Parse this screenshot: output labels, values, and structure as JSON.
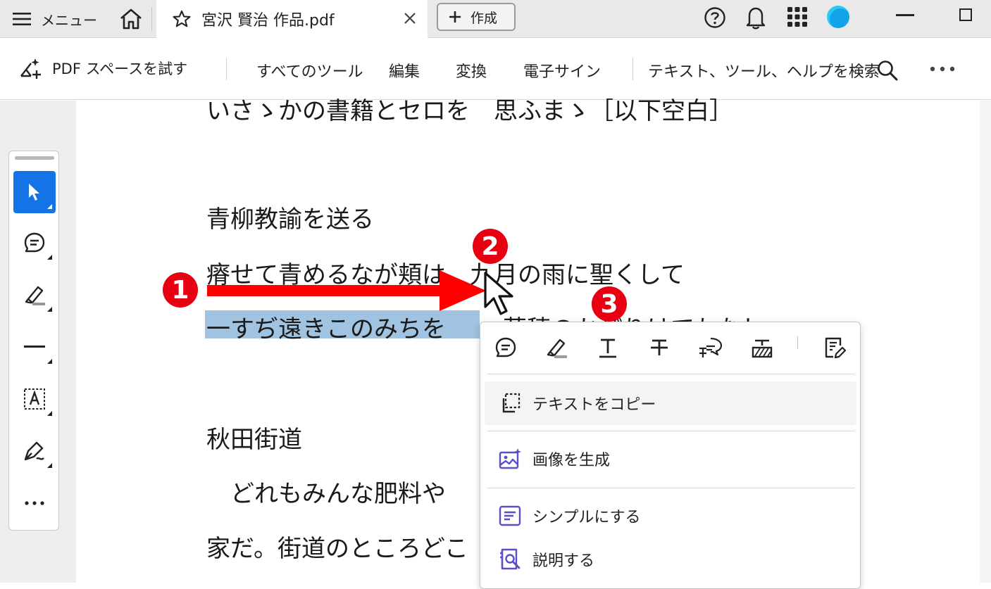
{
  "tabbar": {
    "menu_label": "メニュー",
    "tab_title": "宮沢 賢治 作品.pdf",
    "create_label": "作成",
    "icons": [
      "menu-icon",
      "home-icon",
      "star-icon",
      "close-icon",
      "plus-icon",
      "help-icon",
      "bell-icon",
      "apps-icon",
      "avatar",
      "minimize-icon",
      "maximize-icon"
    ]
  },
  "toolbar": {
    "pdf_space_label": "PDF スペースを試す",
    "items": [
      "すべてのツール",
      "編集",
      "変換",
      "電子サイン"
    ],
    "search_label": "テキスト、ツール、ヘルプを検索"
  },
  "rail": {
    "tools": [
      "select-tool",
      "comment-tool",
      "highlight-tool",
      "line-tool",
      "text-box-tool",
      "draw-tool",
      "more-tools"
    ],
    "more_label": "…"
  },
  "document": {
    "line_top": "いさゝかの書籍とセロを　思ふまゝ［以下空白］",
    "heading1": "青柳教諭を送る",
    "line2": "瘠せて青めるなが頬は　九月の雨に聖くして",
    "line3_selected": "一すぢ遠きこのみちを",
    "line3_rest": "　草穂のかぜりけてもなし",
    "heading2": "秋田街道",
    "line4": "　どれもみんな肥料や",
    "line5": "家だ。街道のところどこ"
  },
  "callouts": [
    "1",
    "2",
    "3"
  ],
  "popup": {
    "icons": [
      "comment-icon",
      "highlight-icon",
      "underline-icon",
      "strikethrough-icon",
      "replace-text-icon",
      "redact-icon",
      "edit-text-icon"
    ],
    "items": [
      {
        "label": "テキストをコピー",
        "icon": "copy-icon"
      },
      {
        "label": "画像を生成",
        "icon": "generate-image-icon"
      },
      {
        "label": "シンプルにする",
        "icon": "simplify-icon"
      },
      {
        "label": "説明する",
        "icon": "explain-icon"
      }
    ]
  },
  "colors": {
    "accent": "#1473e6",
    "callout_red": "#e60012",
    "selection": "#9fc3e0",
    "popup_icon_purple": "#5b4fc7"
  }
}
